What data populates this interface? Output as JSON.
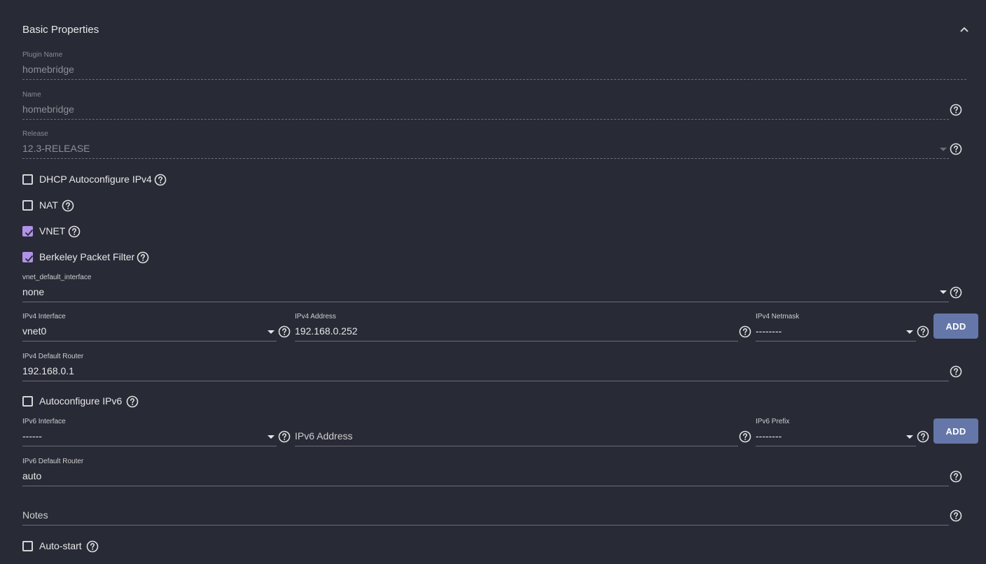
{
  "section": {
    "title": "Basic Properties",
    "collapse_icon": "chevron-up-icon"
  },
  "fields": {
    "plugin_name": {
      "label": "Plugin Name",
      "value": "homebridge"
    },
    "name": {
      "label": "Name",
      "value": "homebridge"
    },
    "release": {
      "label": "Release",
      "value": "12.3-RELEASE"
    },
    "vnet_default_interface": {
      "label": "vnet_default_interface",
      "value": "none"
    },
    "ipv4_interface": {
      "label": "IPv4 Interface",
      "value": "vnet0"
    },
    "ipv4_address": {
      "label": "IPv4 Address",
      "value": "192.168.0.252"
    },
    "ipv4_netmask": {
      "label": "IPv4 Netmask",
      "value": "--------"
    },
    "ipv4_default_router": {
      "label": "IPv4 Default Router",
      "value": "192.168.0.1"
    },
    "ipv6_interface": {
      "label": "IPv6 Interface",
      "value": "------"
    },
    "ipv6_address": {
      "placeholder": "IPv6 Address"
    },
    "ipv6_prefix": {
      "label": "IPv6 Prefix",
      "value": "--------"
    },
    "ipv6_default_router": {
      "label": "IPv6 Default Router",
      "value": "auto"
    },
    "notes": {
      "placeholder": "Notes"
    }
  },
  "checkboxes": {
    "dhcp": {
      "label": "DHCP Autoconfigure IPv4",
      "checked": false
    },
    "nat": {
      "label": "NAT",
      "checked": false
    },
    "vnet": {
      "label": "VNET",
      "checked": true
    },
    "bpf": {
      "label": "Berkeley Packet Filter",
      "checked": true
    },
    "autoconf_ipv6": {
      "label": "Autoconfigure IPv6",
      "checked": false
    },
    "autostart": {
      "label": "Auto-start",
      "checked": false
    }
  },
  "buttons": {
    "add_ipv4": "ADD",
    "add_ipv6": "ADD"
  },
  "icons": {
    "help": "help-circle-icon",
    "dropdown": "dropdown-arrow-icon",
    "check": "check-icon"
  },
  "colors": {
    "background": "#282a36",
    "checkbox_checked": "#b291e8",
    "button": "#6577a8"
  }
}
